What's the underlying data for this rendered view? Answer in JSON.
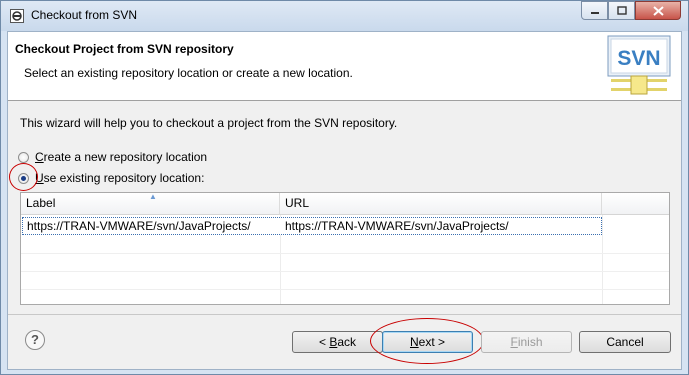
{
  "window": {
    "title": "Checkout from SVN"
  },
  "banner": {
    "title": "Checkout Project from SVN repository",
    "subtitle": "Select an existing repository location or create a new location.",
    "logo_text": "SVN"
  },
  "intro": "This wizard will help you to checkout a project from the SVN repository.",
  "options": [
    {
      "prefix": "",
      "mnemonic": "C",
      "rest": "reate a new repository location",
      "selected": false
    },
    {
      "prefix": "",
      "mnemonic": "U",
      "rest": "se existing repository location:",
      "selected": true
    }
  ],
  "table": {
    "columns": [
      "Label",
      "URL"
    ],
    "rows": [
      {
        "label": "https://TRAN-VMWARE/svn/JavaProjects/",
        "url": "https://TRAN-VMWARE/svn/JavaProjects/"
      }
    ]
  },
  "buttons": {
    "help": "?",
    "back": {
      "prefix": "< ",
      "mnemonic": "B",
      "rest": "ack"
    },
    "next": {
      "prefix": "",
      "mnemonic": "N",
      "rest": "ext >"
    },
    "finish": {
      "prefix": "",
      "mnemonic": "F",
      "rest": "inish"
    },
    "cancel": "Cancel"
  },
  "colors": {
    "annotation": "#c80000",
    "radio_selected": "#1b3d86"
  }
}
